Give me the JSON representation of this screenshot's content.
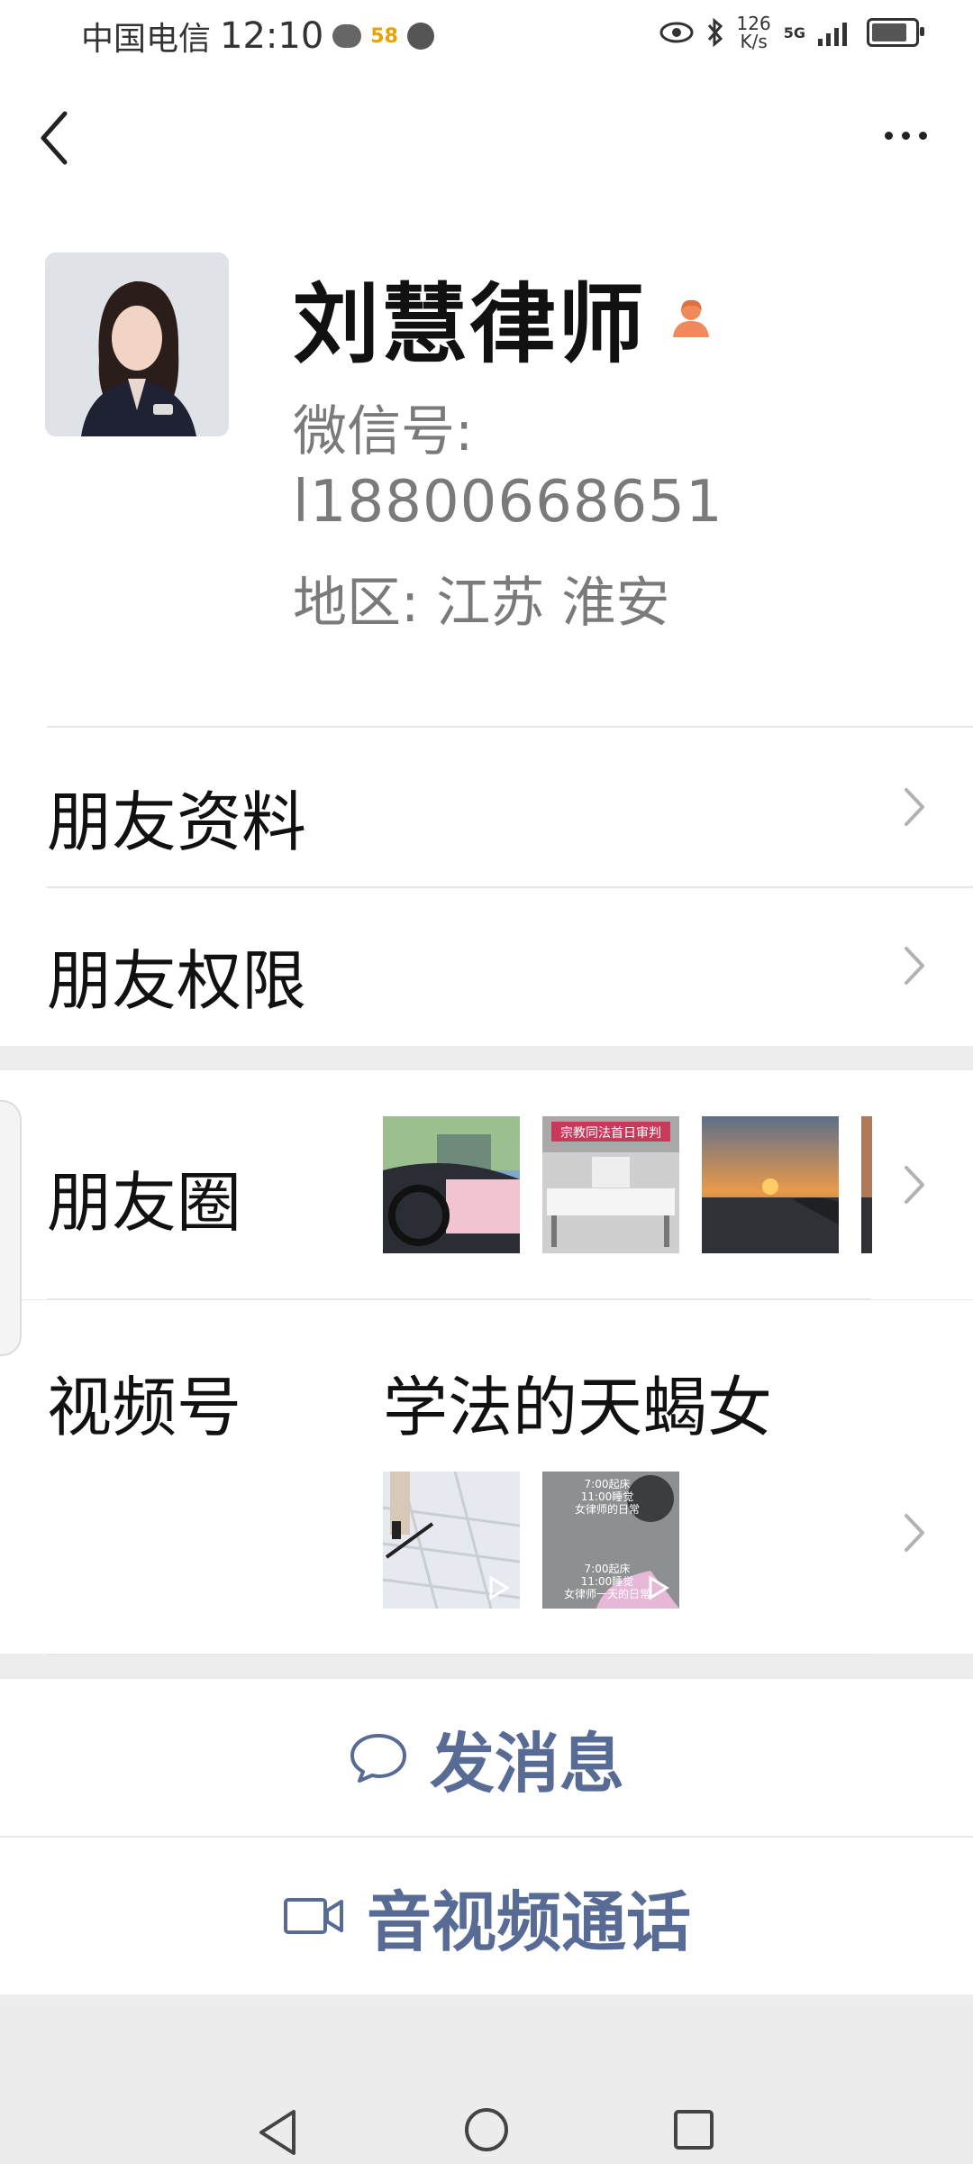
{
  "status_bar": {
    "carrier": "中国电信",
    "time": "12:10",
    "notification_badge": "58",
    "net_speed_value": "126",
    "net_speed_unit": "K/s",
    "network": "5G",
    "icons": [
      "wechat-icon",
      "app-58-icon",
      "audio-icon",
      "eye-icon",
      "bluetooth-icon",
      "signal-icon",
      "battery-icon"
    ]
  },
  "profile": {
    "name": "刘慧律师",
    "wechat_id_label": "微信号:",
    "wechat_id": "l18800668651",
    "region": "地区:  江苏  淮安"
  },
  "menu": {
    "friend_info": "朋友资料",
    "friend_permissions": "朋友权限",
    "moments": "朋友圈",
    "channels": "视频号",
    "channels_name": "学法的天蝎女"
  },
  "video_thumb": {
    "line1": "7:00起床",
    "line2": "11:00睡觉",
    "line3": "女律师的日常",
    "line4": "7:00起床",
    "line5": "11:00睡觉",
    "line6": "女律师一天的日常"
  },
  "moments_thumb_banner": "宗教同法首日审判",
  "actions": {
    "send_message": "发消息",
    "av_call": "音视频通话"
  },
  "colors": {
    "link_blue": "#576b95",
    "badge_orange": "#f08a5d"
  }
}
